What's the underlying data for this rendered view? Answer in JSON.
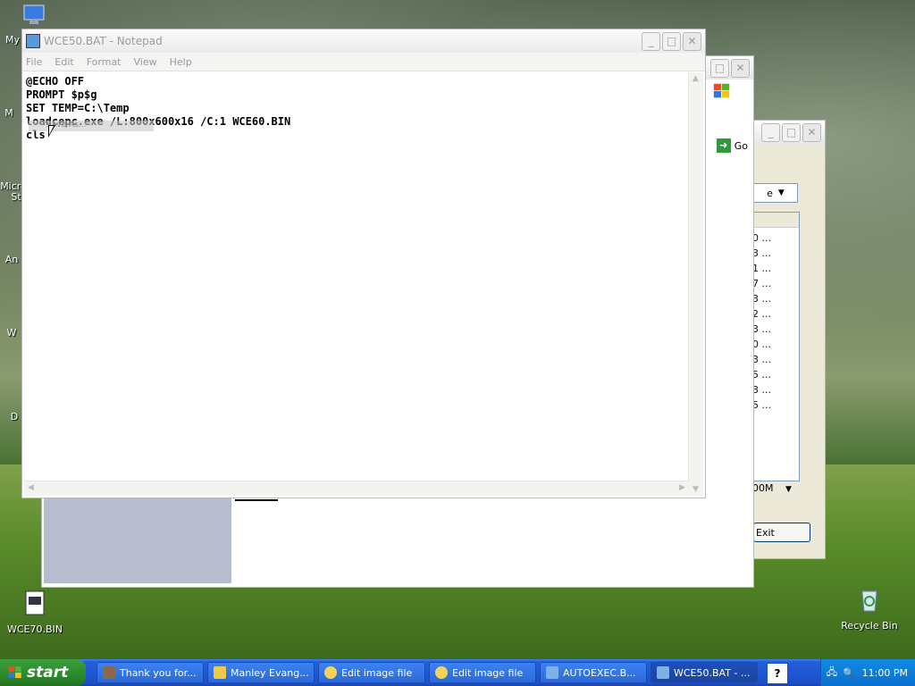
{
  "desktop": {
    "icons": [
      {
        "label": "My",
        "kind": "computer"
      },
      {
        "label": "WCE70.BIN",
        "kind": "file"
      },
      {
        "label": "Recycle Bin",
        "kind": "recycle"
      }
    ],
    "partial_labels": [
      "M",
      "Micro",
      "St",
      "An",
      "W",
      "D"
    ]
  },
  "notepad": {
    "title": "WCE50.BAT - Notepad",
    "menu": [
      "File",
      "Edit",
      "Format",
      "View",
      "Help"
    ],
    "lines": [
      "@ECHO OFF",
      "PROMPT $p$g",
      "SET TEMP=C:\\Temp",
      "loadcepc.exe /L:800x600x16 /C:1 WCE60.BIN",
      "cls"
    ],
    "tooltip": "Save As..."
  },
  "background_window": {
    "go_label": "Go",
    "dropdown_suffix": "e",
    "list_values": [
      "0 ...",
      "3 ...",
      "1 ...",
      "7 ...",
      "3 ...",
      "2 ...",
      "3 ...",
      "0 ...",
      "3 ...",
      "5 ...",
      "3 ...",
      "5 ..."
    ],
    "size_value": "00M",
    "exit_label": "Exit"
  },
  "taskbar": {
    "start_label": "start",
    "items": [
      {
        "label": "Thank you for..."
      },
      {
        "label": "Manley Evang..."
      },
      {
        "label": "Edit image file"
      },
      {
        "label": "Edit image file"
      },
      {
        "label": "AUTOEXEC.B..."
      },
      {
        "label": "WCE50.BAT - ..."
      }
    ],
    "clock": "11:00 PM",
    "help_glyph": "?"
  }
}
